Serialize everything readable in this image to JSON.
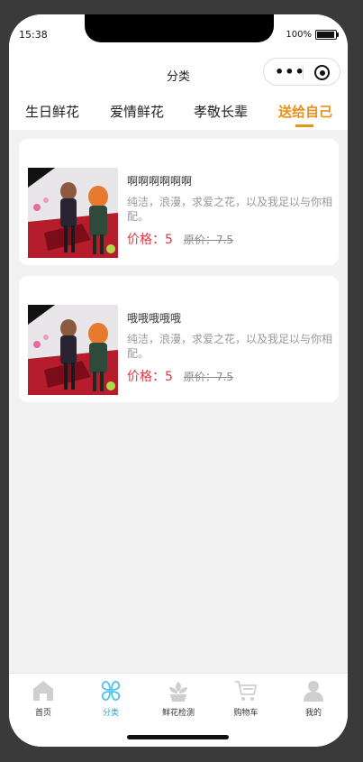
{
  "status": {
    "time": "15:38",
    "battery": "100%"
  },
  "navbar": {
    "title": "分类"
  },
  "tabs": [
    {
      "label": "生日鲜花",
      "active": false
    },
    {
      "label": "爱情鲜花",
      "active": false
    },
    {
      "label": "孝敬长辈",
      "active": false
    },
    {
      "label": "送给自己",
      "active": true
    }
  ],
  "products": [
    {
      "title": "啊啊啊啊啊啊",
      "desc": "纯洁，浪漫，求爱之花，以及我足以与你相配。",
      "price_label": "价格：",
      "price": "5",
      "orig_label": "原价：",
      "orig_price": "7.5"
    },
    {
      "title": "哦哦哦哦哦",
      "desc": "纯洁，浪漫，求爱之花，以及我足以与你相配。",
      "price_label": "价格：",
      "price": "5",
      "orig_label": "原价：",
      "orig_price": "7.5"
    }
  ],
  "tabbar": {
    "items": [
      {
        "label": "首页",
        "icon": "home-icon"
      },
      {
        "label": "分类",
        "icon": "category-icon",
        "active": true
      },
      {
        "label": "鲜花检测",
        "icon": "flower-icon"
      },
      {
        "label": "购物车",
        "icon": "cart-icon"
      },
      {
        "label": "我的",
        "icon": "user-icon"
      }
    ]
  },
  "colors": {
    "accent": "#e8911b",
    "price": "#e8343f",
    "tab_active": "#29a3d6"
  }
}
